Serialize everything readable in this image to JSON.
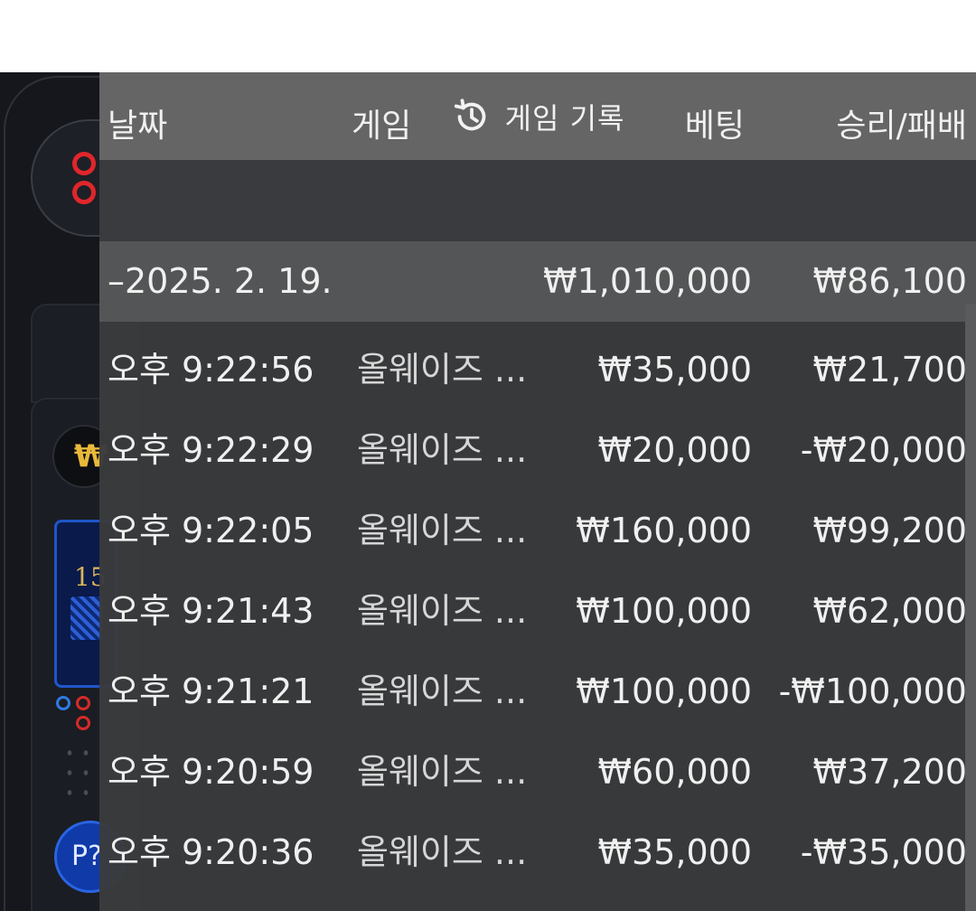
{
  "background": {
    "coin_symbol": "₩",
    "thumbnail_number": "15",
    "p_button_label": "P?"
  },
  "modal": {
    "title": "게임 기록",
    "icon": "history-icon",
    "columns": {
      "date": "날짜",
      "game": "게임",
      "bet": "베팅",
      "result": "승리/패배"
    },
    "date_group": {
      "label": "–2025. 2. 19.",
      "bet": "₩1,010,000",
      "result": "₩86,100"
    },
    "rows": [
      {
        "time": "오후 9:22:56",
        "game": "올웨이즈 ...",
        "bet": "₩35,000",
        "result": "₩21,700"
      },
      {
        "time": "오후 9:22:29",
        "game": "올웨이즈 ...",
        "bet": "₩20,000",
        "result": "-₩20,000"
      },
      {
        "time": "오후 9:22:05",
        "game": "올웨이즈 ...",
        "bet": "₩160,000",
        "result": "₩99,200"
      },
      {
        "time": "오후 9:21:43",
        "game": "올웨이즈 ...",
        "bet": "₩100,000",
        "result": "₩62,000"
      },
      {
        "time": "오후 9:21:21",
        "game": "올웨이즈 ...",
        "bet": "₩100,000",
        "result": "-₩100,000"
      },
      {
        "time": "오후 9:20:59",
        "game": "올웨이즈 ...",
        "bet": "₩60,000",
        "result": "₩37,200"
      },
      {
        "time": "오후 9:20:36",
        "game": "올웨이즈 ...",
        "bet": "₩35,000",
        "result": "-₩35,000"
      }
    ]
  }
}
